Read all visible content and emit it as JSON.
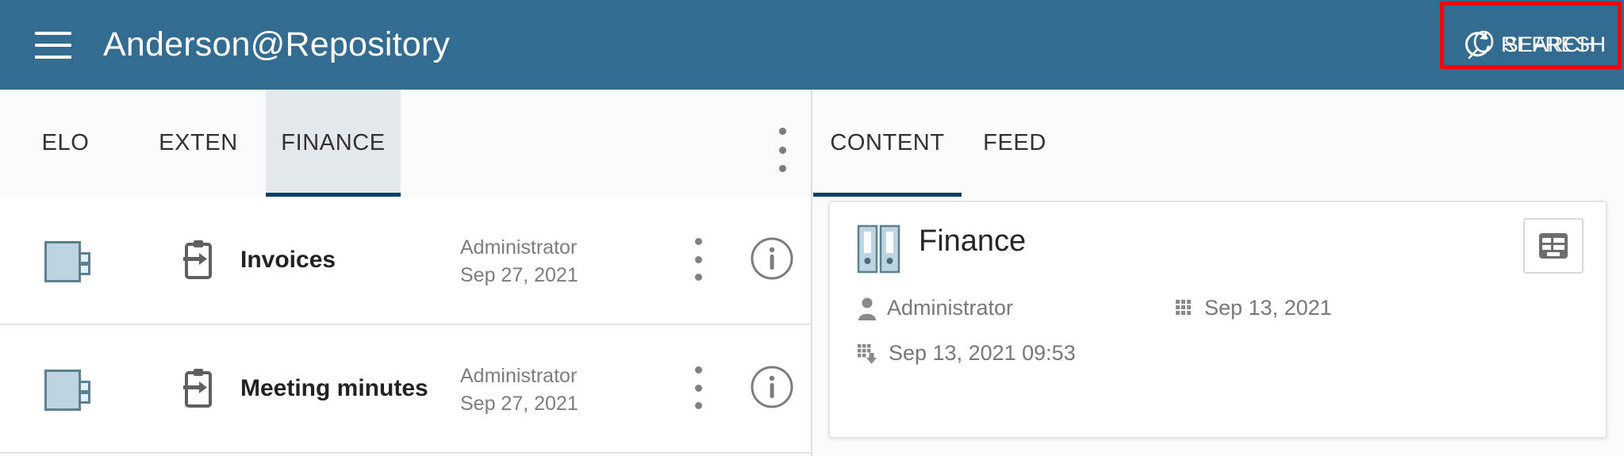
{
  "header": {
    "menu_icon": "hamburger-menu-icon",
    "title": "Anderson@Repository",
    "actions": [
      {
        "icon": "search-icon",
        "label": "SEARCH"
      },
      {
        "icon": "refresh-icon",
        "label": "REFRESH"
      }
    ],
    "highlight_color": "#fb0007",
    "background_color": "#336b91"
  },
  "left_pane": {
    "tabs": [
      {
        "label": "ELO",
        "active": false
      },
      {
        "label": "EXTEN",
        "active": false
      },
      {
        "label": "FINANCE",
        "active": true
      }
    ],
    "overflow_icon": "kebab-menu-icon",
    "active_tab_color": "#0d3f63",
    "rows": [
      {
        "type_icon": "folder-icon",
        "doc_icon": "clipboard-import-icon",
        "title": "Invoices",
        "author": "Administrator",
        "date": "Sep 27, 2021",
        "menu_icon": "kebab-menu-icon",
        "info_icon": "info-circle-icon"
      },
      {
        "type_icon": "folder-icon",
        "doc_icon": "clipboard-import-icon",
        "title": "Meeting minutes",
        "author": "Administrator",
        "date": "Sep 27, 2021",
        "menu_icon": "kebab-menu-icon",
        "info_icon": "info-circle-icon"
      }
    ]
  },
  "right_pane": {
    "tabs": [
      {
        "label": "CONTENT",
        "active": true
      },
      {
        "label": "FEED",
        "active": false
      }
    ],
    "card": {
      "icon": "binders-icon",
      "title": "Finance",
      "action_icon": "form-table-icon",
      "meta": {
        "author_icon": "person-icon",
        "author": "Administrator",
        "created_icon": "calendar-grid-icon",
        "created": "Sep 13, 2021",
        "modified_icon": "calendar-download-icon",
        "modified": "Sep 13, 2021 09:53"
      }
    }
  }
}
